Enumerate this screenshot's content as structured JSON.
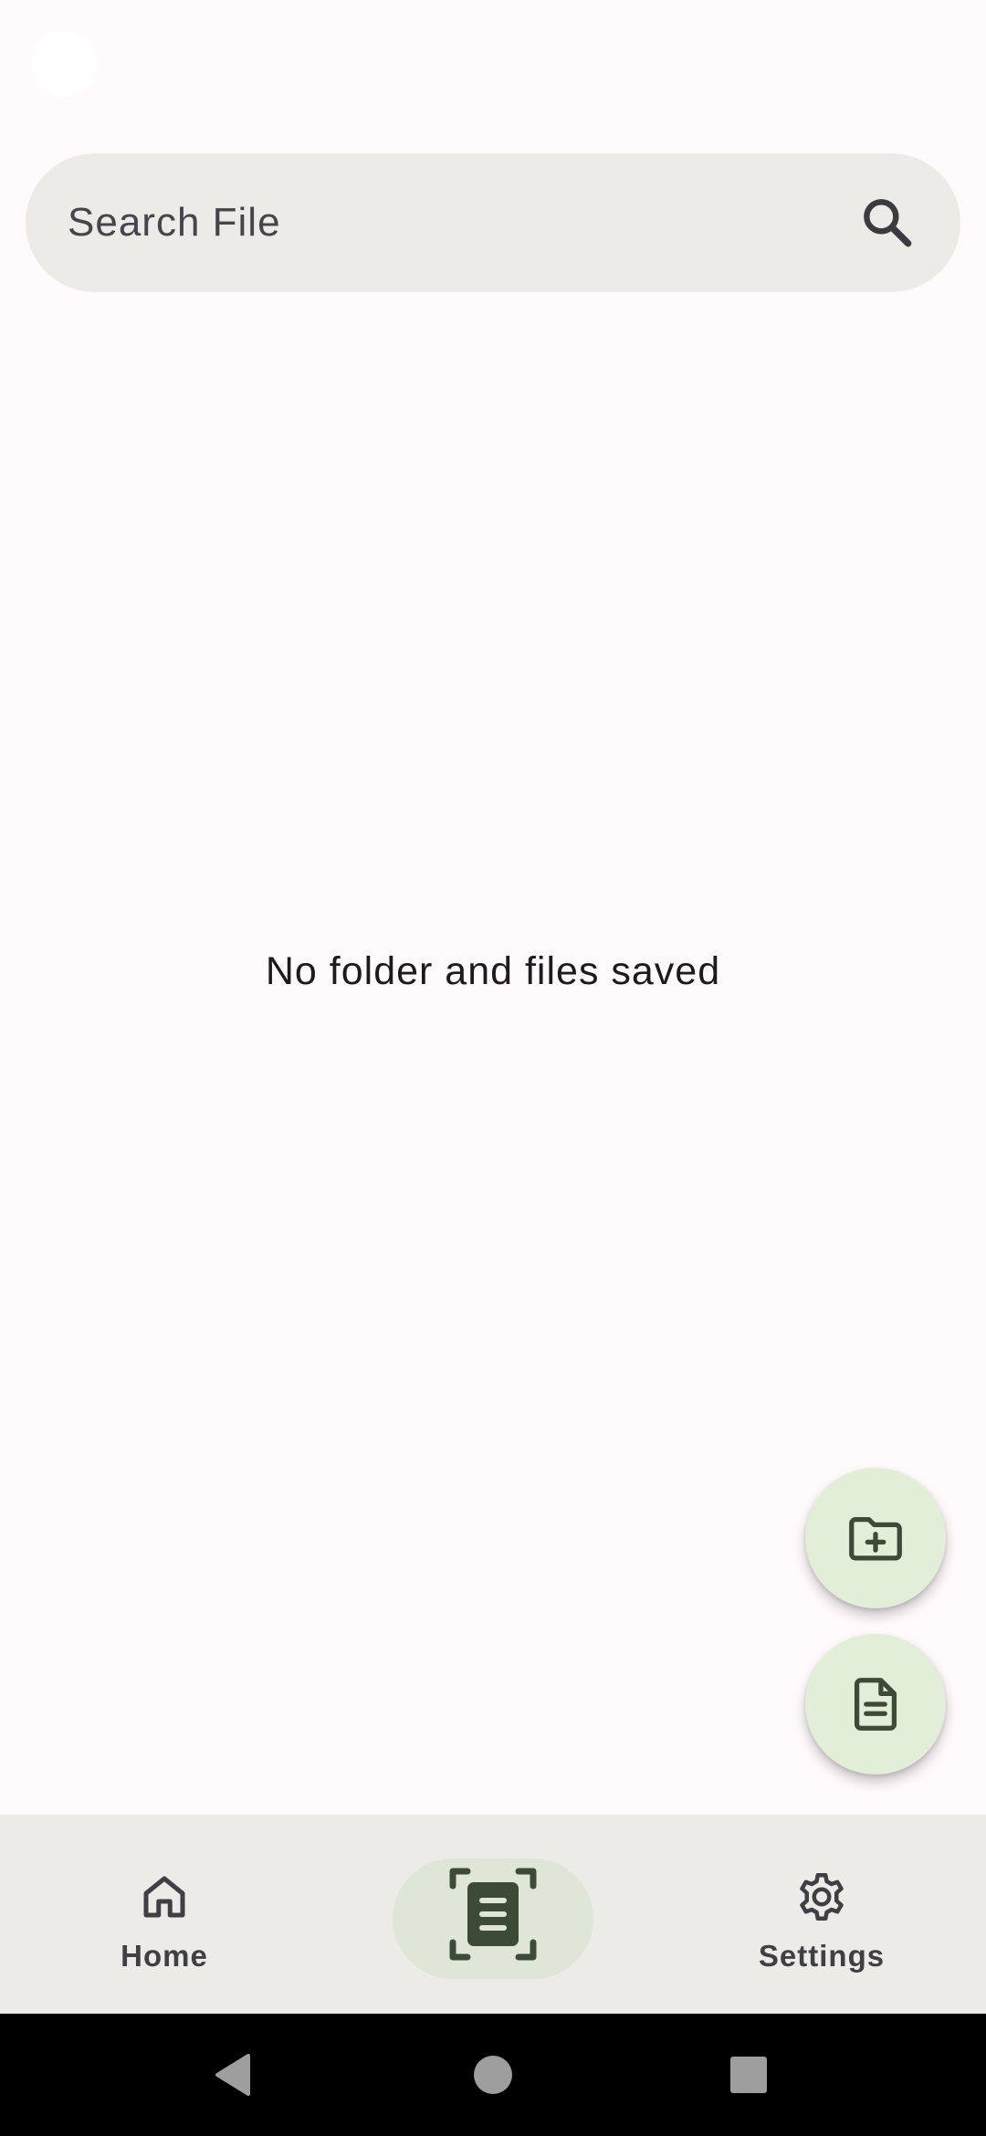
{
  "search": {
    "placeholder": "Search File",
    "icon": "search-icon"
  },
  "empty_state": {
    "message": "No folder and files saved"
  },
  "fabs": [
    {
      "icon": "folder-add-icon"
    },
    {
      "icon": "document-icon"
    }
  ],
  "bottom_nav": {
    "items": [
      {
        "label": "Home",
        "icon": "home-icon"
      },
      {
        "label": "",
        "icon": "document-scanner-icon",
        "selected": true
      },
      {
        "label": "Settings",
        "icon": "gear-icon"
      }
    ]
  },
  "colors": {
    "background": "#fffafc",
    "surface": "#ecebe7",
    "fab": "#e2eed8",
    "accent_dark": "#3d4a37",
    "nav_selected_pill": "#dfe6d8"
  }
}
